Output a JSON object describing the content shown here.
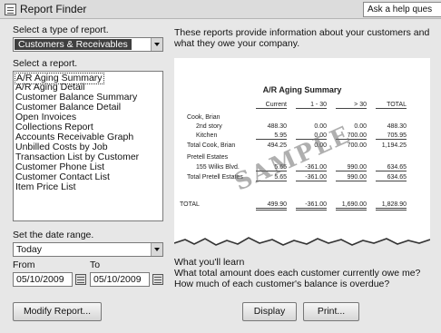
{
  "window": {
    "title": "Report Finder",
    "help_placeholder": "Ask a help ques"
  },
  "left": {
    "type_label": "Select a type of report.",
    "type_value": "Customers & Receivables",
    "report_label": "Select a report.",
    "reports": [
      "A/R Aging Summary",
      "A/R Aging Detail",
      "Customer Balance Summary",
      "Customer Balance Detail",
      "Open Invoices",
      "Collections Report",
      "Accounts Receivable Graph",
      "Unbilled Costs by Job",
      "Transaction List by Customer",
      "Customer Phone List",
      "Customer Contact List",
      "Item Price List"
    ],
    "date_range_label": "Set the date range.",
    "date_range_value": "Today",
    "from_label": "From",
    "to_label": "To",
    "from_value": "05/10/2009",
    "to_value": "05/10/2009"
  },
  "right": {
    "intro": "These reports provide information about your customers and what they owe your company.",
    "learn_title": "What you'll learn",
    "learn_text": "What total amount does each customer currently owe me? How much of each customer's balance is overdue?"
  },
  "sample": {
    "title": "A/R Aging Summary",
    "columns": [
      "Current",
      "1 - 30",
      "> 30",
      "TOTAL"
    ],
    "rows": [
      {
        "label": "Cook, Brian",
        "values": [
          "",
          "",
          "",
          ""
        ]
      },
      {
        "label": "2nd story",
        "values": [
          "488.30",
          "0.00",
          "0.00",
          "488.30"
        ]
      },
      {
        "label": "Kitchen",
        "values": [
          "5.95",
          "0.00",
          "700.00",
          "705.95"
        ]
      },
      {
        "label": "Total Cook, Brian",
        "values": [
          "494.25",
          "0.00",
          "700.00",
          "1,194.25"
        ]
      },
      {
        "label": "Pretell Estates",
        "values": [
          "",
          "",
          "",
          ""
        ]
      },
      {
        "label": "155 Wilks Blvd.",
        "values": [
          "5.65",
          "-361.00",
          "990.00",
          "634.65"
        ]
      },
      {
        "label": "Total Pretell Estates",
        "values": [
          "5.65",
          "-361.00",
          "990.00",
          "634.65"
        ]
      },
      {
        "label": "TOTAL",
        "values": [
          "499.90",
          "-361.00",
          "1,690.00",
          "1,828.90"
        ]
      }
    ],
    "stamp": "SAMPLE"
  },
  "buttons": {
    "modify": "Modify Report...",
    "display": "Display",
    "print": "Print..."
  }
}
